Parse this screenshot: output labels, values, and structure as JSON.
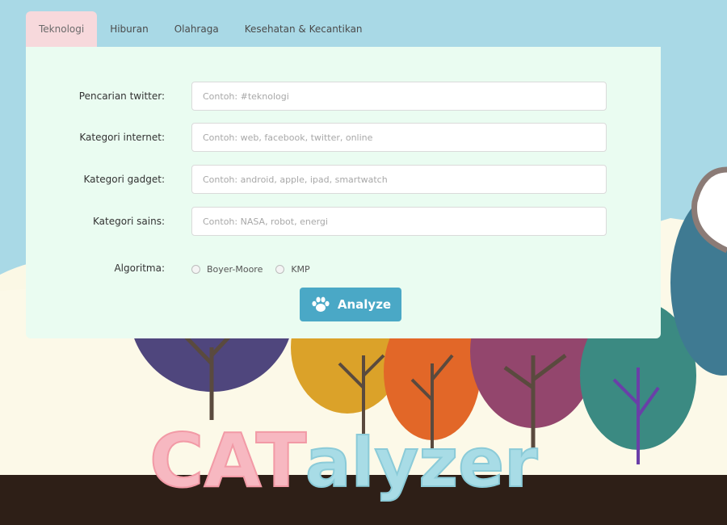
{
  "tabs": [
    {
      "label": "Teknologi",
      "active": true
    },
    {
      "label": "Hiburan",
      "active": false
    },
    {
      "label": "Olahraga",
      "active": false
    },
    {
      "label": "Kesehatan & Kecantikan",
      "active": false
    }
  ],
  "form": {
    "fields": [
      {
        "label": "Pencarian twitter:",
        "placeholder": "Contoh: #teknologi"
      },
      {
        "label": "Kategori internet:",
        "placeholder": "Contoh: web, facebook, twitter, online"
      },
      {
        "label": "Kategori gadget:",
        "placeholder": "Contoh: android, apple, ipad, smartwatch"
      },
      {
        "label": "Kategori sains:",
        "placeholder": "Contoh: NASA, robot, energi"
      }
    ],
    "algorithm": {
      "label": "Algoritma:",
      "options": [
        "Boyer-Moore",
        "KMP"
      ]
    },
    "analyze_label": "Analyze"
  },
  "logo": {
    "text_part1": "CAT",
    "text_part2": "alyzer"
  },
  "colors": {
    "sky": "#a9d9e6",
    "tab_active": "#f7d9dc",
    "panel": "#eafcf1",
    "button": "#4aa8c6",
    "logo_pink": "#f7b8c1",
    "logo_blue": "#a8dce6",
    "ground": "#2e1f17"
  },
  "icons": {
    "analyze_icon": "paw-icon"
  }
}
